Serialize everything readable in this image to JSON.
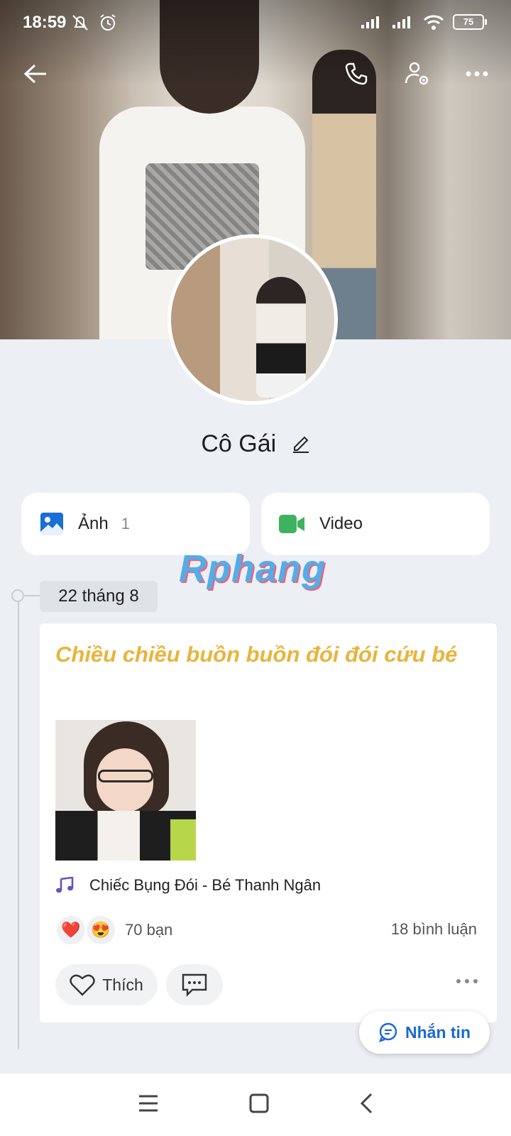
{
  "status_bar": {
    "time": "18:59",
    "battery": "75",
    "icons": [
      "mute-icon",
      "alarm-icon",
      "signal-icon",
      "signal-icon",
      "wifi-icon",
      "battery-icon"
    ]
  },
  "top_nav": {
    "icons": [
      "back-arrow-icon",
      "phone-icon",
      "user-settings-icon",
      "more-icon"
    ]
  },
  "profile": {
    "name": "Cô Gái"
  },
  "media_tiles": [
    {
      "label": "Ảnh",
      "count": "1",
      "icon": "image-icon",
      "color": "#1a6fd6"
    },
    {
      "label": "Video",
      "count": "",
      "icon": "video-icon",
      "color": "#3fb25f"
    }
  ],
  "watermark": "Rphang",
  "timeline": {
    "date": "22 tháng 8"
  },
  "post": {
    "title": "Chiều chiều buồn buồn đói đói cứu bé",
    "music": "Chiếc Bụng Đói - Bé Thanh Ngân",
    "reaction_count": "70 bạn",
    "reactions": [
      "❤️",
      "😍"
    ],
    "comments": "18 bình luận",
    "like_label": "Thích"
  },
  "message_button": "Nhắn tin",
  "colors": {
    "accent": "#1a67d6",
    "title": "#e9b43c",
    "music_icon": "#6d4fc0"
  }
}
